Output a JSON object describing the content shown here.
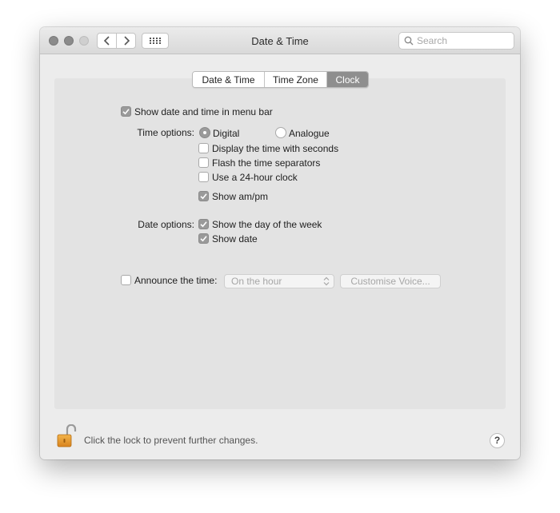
{
  "window": {
    "title": "Date & Time"
  },
  "search": {
    "placeholder": "Search"
  },
  "tabs": [
    {
      "label": "Date & Time",
      "selected": false
    },
    {
      "label": "Time Zone",
      "selected": false
    },
    {
      "label": "Clock",
      "selected": true
    }
  ],
  "clock": {
    "show_in_menu_bar": {
      "label": "Show date and time in menu bar",
      "checked": true
    },
    "time_options_label": "Time options:",
    "digital": {
      "label": "Digital",
      "selected": true
    },
    "analogue": {
      "label": "Analogue",
      "selected": false
    },
    "display_seconds": {
      "label": "Display the time with seconds",
      "checked": false
    },
    "flash_separators": {
      "label": "Flash the time separators",
      "checked": false
    },
    "use_24_hour": {
      "label": "Use a 24-hour clock",
      "checked": false
    },
    "show_ampm": {
      "label": "Show am/pm",
      "checked": true
    },
    "date_options_label": "Date options:",
    "show_day_of_week": {
      "label": "Show the day of the week",
      "checked": true
    },
    "show_date": {
      "label": "Show date",
      "checked": true
    },
    "announce_time": {
      "label": "Announce the time:",
      "checked": false
    },
    "announce_interval": "On the hour",
    "customise_voice": "Customise Voice..."
  },
  "footer": {
    "lock_text": "Click the lock to prevent further changes.",
    "help": "?"
  },
  "colors": {
    "selected_tab": "#8e8e8e",
    "checked_control": "#9a9a9a",
    "lock_body": "#e39a2c"
  }
}
